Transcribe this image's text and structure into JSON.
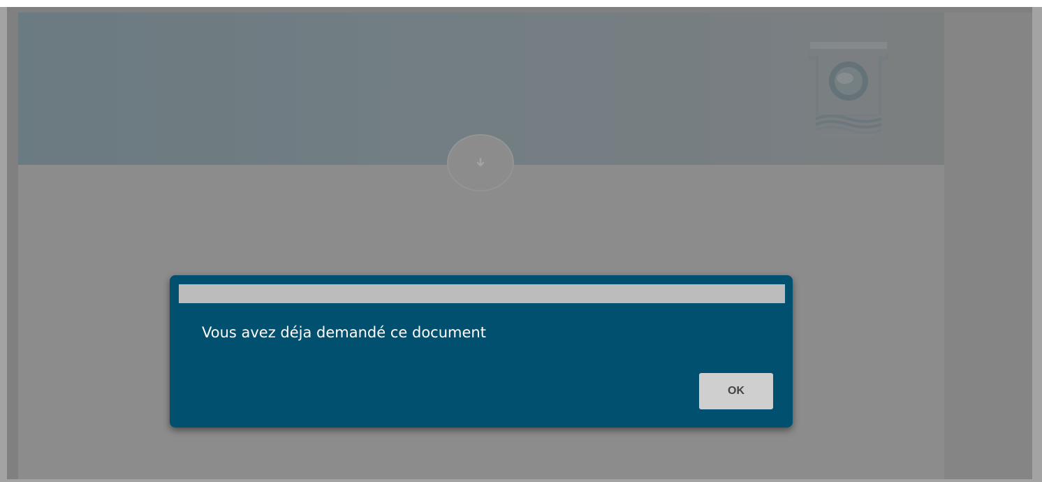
{
  "dialog": {
    "title": "",
    "message": "Vous avez déja demandé ce document",
    "ok_label": "OK"
  },
  "icons": {
    "scroll_down": "arrow-down-icon",
    "logo": "institution-logo"
  },
  "colors": {
    "dialog_background": "#02506f",
    "dialog_titlebar": "#bcbcbc",
    "button_background": "#cfcfcf",
    "button_text": "#444444"
  }
}
